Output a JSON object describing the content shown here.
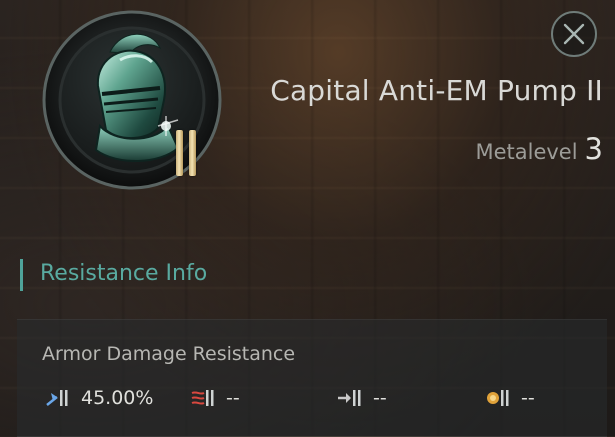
{
  "item": {
    "name": "Capital Anti-EM Pump II",
    "tier": "II",
    "icon": "helmet-module-icon"
  },
  "metalevel": {
    "label": "Metalevel",
    "value": "3"
  },
  "close_icon": "close-icon",
  "section": {
    "title": "Resistance Info"
  },
  "armor": {
    "label": "Armor Damage Resistance",
    "resistances": [
      {
        "type": "em",
        "icon": "em-damage-icon",
        "value": "45.00%",
        "color": "#6aa6e8"
      },
      {
        "type": "thermal",
        "icon": "thermal-damage-icon",
        "value": "--",
        "color": "#d9483f"
      },
      {
        "type": "kinetic",
        "icon": "kinetic-damage-icon",
        "value": "--",
        "color": "#c9c9c9"
      },
      {
        "type": "explosive",
        "icon": "explosive-damage-icon",
        "value": "--",
        "color": "#e0a23a"
      }
    ]
  },
  "colors": {
    "accent": "#59aaa0",
    "title_text": "#d9d9d6"
  }
}
